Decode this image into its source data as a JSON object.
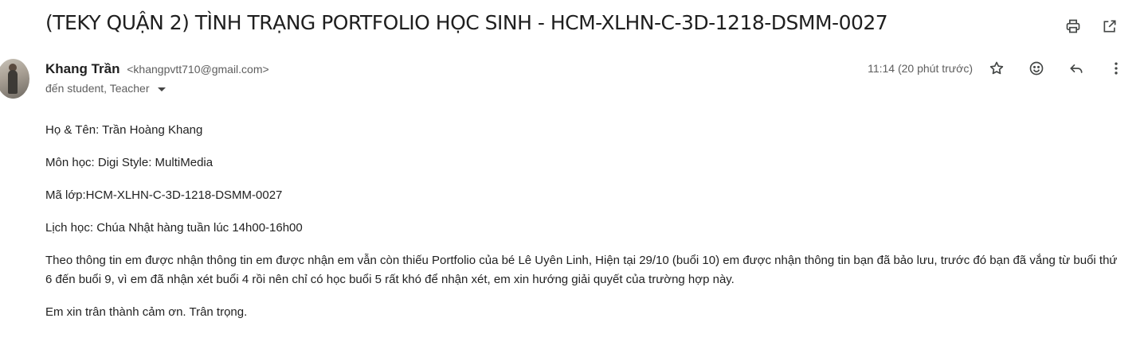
{
  "subject": "(TEKY QUẬN 2) TÌNH TRẠNG PORTFOLIO HỌC SINH - HCM-XLHN-C-3D-1218-DSMM-0027",
  "top_actions": {
    "print_icon": "print-icon",
    "open_new_window_icon": "open-in-new-window-icon"
  },
  "sender": {
    "name": "Khang Trần",
    "email": "<khangpvtt710@gmail.com>"
  },
  "recipients": "đến student, Teacher",
  "timestamp": "11:14 (20 phút trước)",
  "actions": {
    "star": "star-icon",
    "emoji": "emoji-icon",
    "reply": "reply-icon",
    "more": "more-vert-icon"
  },
  "body": {
    "line1": "Họ & Tên: Trần Hoàng Khang",
    "line2": "Môn học: Digi Style: MultiMedia",
    "line3": "Mã lớp:HCM-XLHN-C-3D-1218-DSMM-0027",
    "line4": "Lịch học: Chúa Nhật hàng tuần lúc 14h00-16h00",
    "line5": "Theo thông tin em được nhận thông tin em được nhận em vẫn còn thiếu  Portfolio của bé Lê Uyên Linh, Hiện tại 29/10 (buổi 10) em được nhận thông tin bạn đã bảo lưu, trước đó bạn đã vắng từ buổi thứ 6 đến buổi 9, vì em đã nhận xét buổi 4 rồi nên chỉ có học buổi 5 rất khó để nhận xét, em xin hướng giải quyết của trường hợp này.",
    "line6": "Em xin trân thành cảm ơn. Trân trọng."
  },
  "colors": {
    "text": "#222222",
    "muted": "#5e5e5e",
    "icon": "#444746"
  }
}
